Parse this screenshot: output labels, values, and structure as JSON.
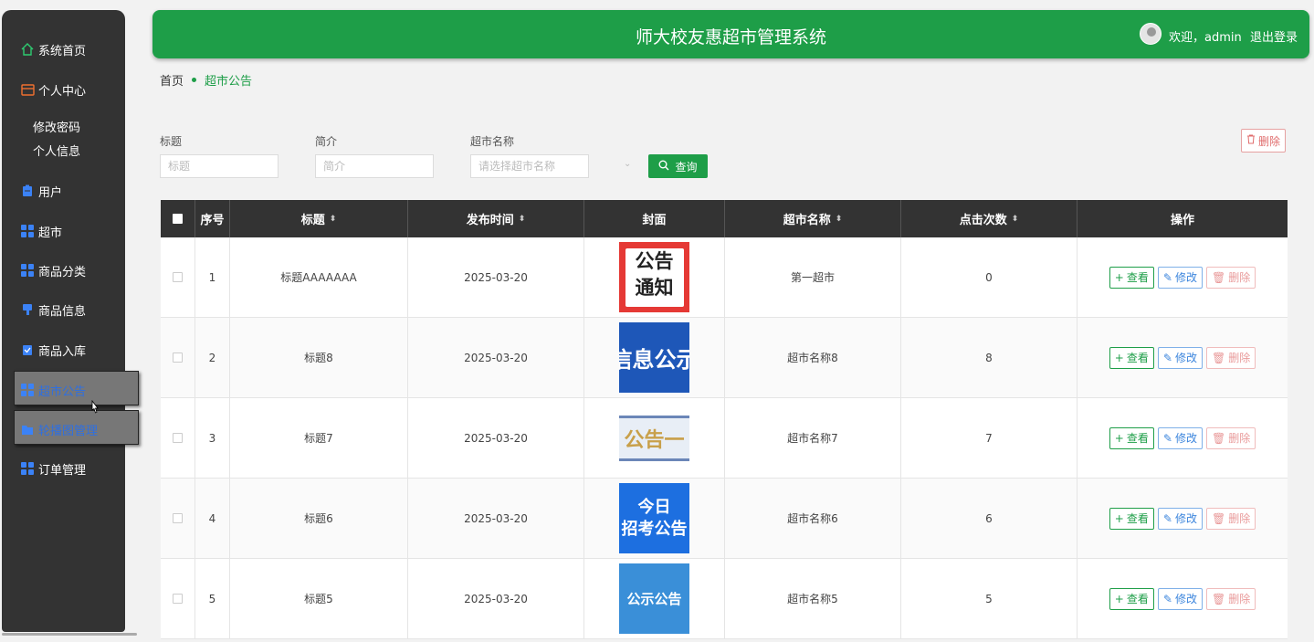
{
  "app": {
    "title": "师大校友惠超市管理系统",
    "welcome": "欢迎，admin",
    "logout": "退出登录",
    "accent": "#1e9e48"
  },
  "sidebar": {
    "items": [
      {
        "label": "系统首页",
        "icon": "home-icon"
      },
      {
        "label": "个人中心",
        "icon": "card-icon"
      },
      {
        "label": "修改密码",
        "icon": ""
      },
      {
        "label": "个人信息",
        "icon": ""
      },
      {
        "label": "用户",
        "icon": "clipboard-icon"
      },
      {
        "label": "超市",
        "icon": "grid-icon"
      },
      {
        "label": "商品分类",
        "icon": "grid-icon"
      },
      {
        "label": "商品信息",
        "icon": "pin-icon"
      },
      {
        "label": "商品入库",
        "icon": "checklist-icon"
      },
      {
        "label": "超市公告",
        "icon": "grid-icon"
      },
      {
        "label": "轮播图管理",
        "icon": "folder-icon"
      },
      {
        "label": "订单管理",
        "icon": "grid-icon"
      }
    ]
  },
  "breadcrumb": {
    "home": "首页",
    "current": "超市公告"
  },
  "filters": {
    "title_label": "标题",
    "title_placeholder": "标题",
    "intro_label": "简介",
    "intro_placeholder": "简介",
    "market_label": "超市名称",
    "market_placeholder": "请选择超市名称",
    "query_label": "查询",
    "delete_label": "删除"
  },
  "table": {
    "headers": [
      "序号",
      "标题",
      "发布时间",
      "封面",
      "超市名称",
      "点击次数",
      "操作"
    ],
    "rows": [
      {
        "index": "1",
        "title": "标题AAAAAAA",
        "date": "2025-03-20",
        "cover": "公告通知",
        "market": "第一超市",
        "clicks": "0"
      },
      {
        "index": "2",
        "title": "标题8",
        "date": "2025-03-20",
        "cover": "信息公示",
        "market": "超市名称8",
        "clicks": "8"
      },
      {
        "index": "3",
        "title": "标题7",
        "date": "2025-03-20",
        "cover": "公告一",
        "market": "超市名称7",
        "clicks": "7"
      },
      {
        "index": "4",
        "title": "标题6",
        "date": "2025-03-20",
        "cover": "今日招考公告",
        "market": "超市名称6",
        "clicks": "6"
      },
      {
        "index": "5",
        "title": "标题5",
        "date": "2025-03-20",
        "cover": "公示公告",
        "market": "超市名称5",
        "clicks": "5"
      }
    ],
    "actions": {
      "view": "查看",
      "edit": "修改",
      "delete": "删除"
    }
  }
}
